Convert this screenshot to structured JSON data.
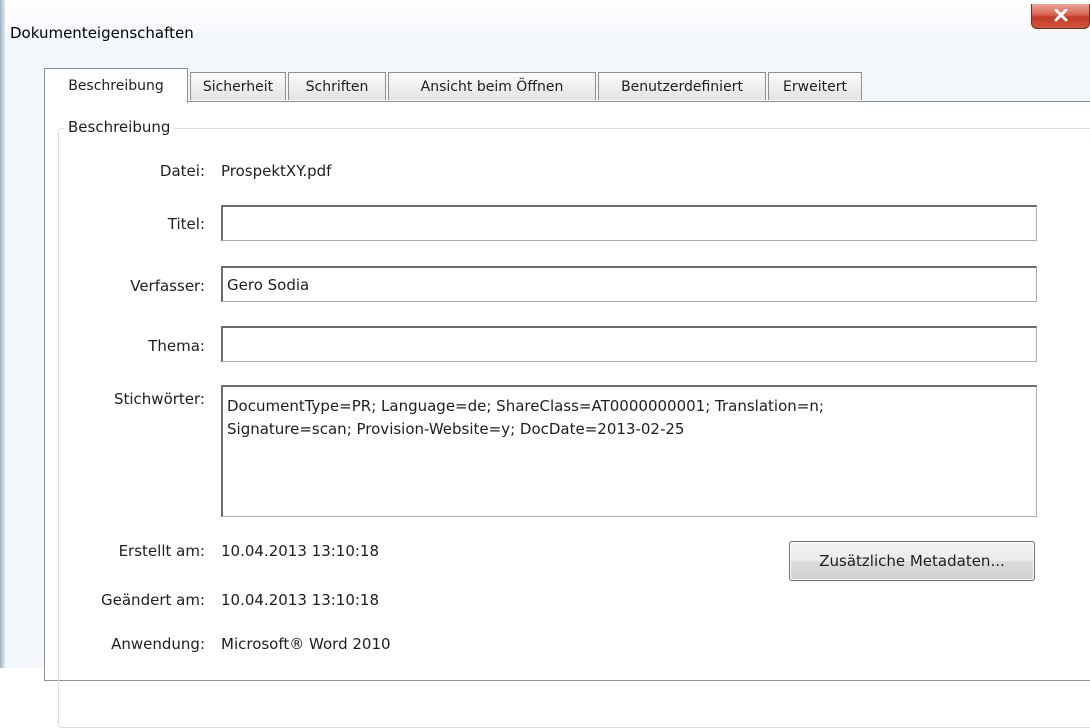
{
  "window": {
    "title": "Dokumenteigenschaften"
  },
  "tabs": [
    {
      "label": "Beschreibung",
      "active": true
    },
    {
      "label": "Sicherheit"
    },
    {
      "label": "Schriften"
    },
    {
      "label": "Ansicht beim Öffnen"
    },
    {
      "label": "Benutzerdefiniert"
    },
    {
      "label": "Erweitert"
    }
  ],
  "description": {
    "group_title": "Beschreibung",
    "file_label": "Datei:",
    "file_value": "ProspektXY.pdf",
    "title_label": "Titel:",
    "title_value": "",
    "author_label": "Verfasser:",
    "author_value": "Gero Sodia",
    "subject_label": "Thema:",
    "subject_value": "",
    "keywords_label": "Stichwörter:",
    "keywords_value": "DocumentType=PR; Language=de; ShareClass=AT0000000001; Translation=n;\nSignature=scan; Provision-Website=y; DocDate=2013-02-25",
    "created_label": "Erstellt am:",
    "created_value": "10.04.2013 13:10:18",
    "modified_label": "Geändert am:",
    "modified_value": "10.04.2013 13:10:18",
    "application_label": "Anwendung:",
    "application_value": "Microsoft® Word 2010",
    "metadata_button": "Zusätzliche Metadaten..."
  },
  "icons": {
    "close": "close-icon"
  }
}
